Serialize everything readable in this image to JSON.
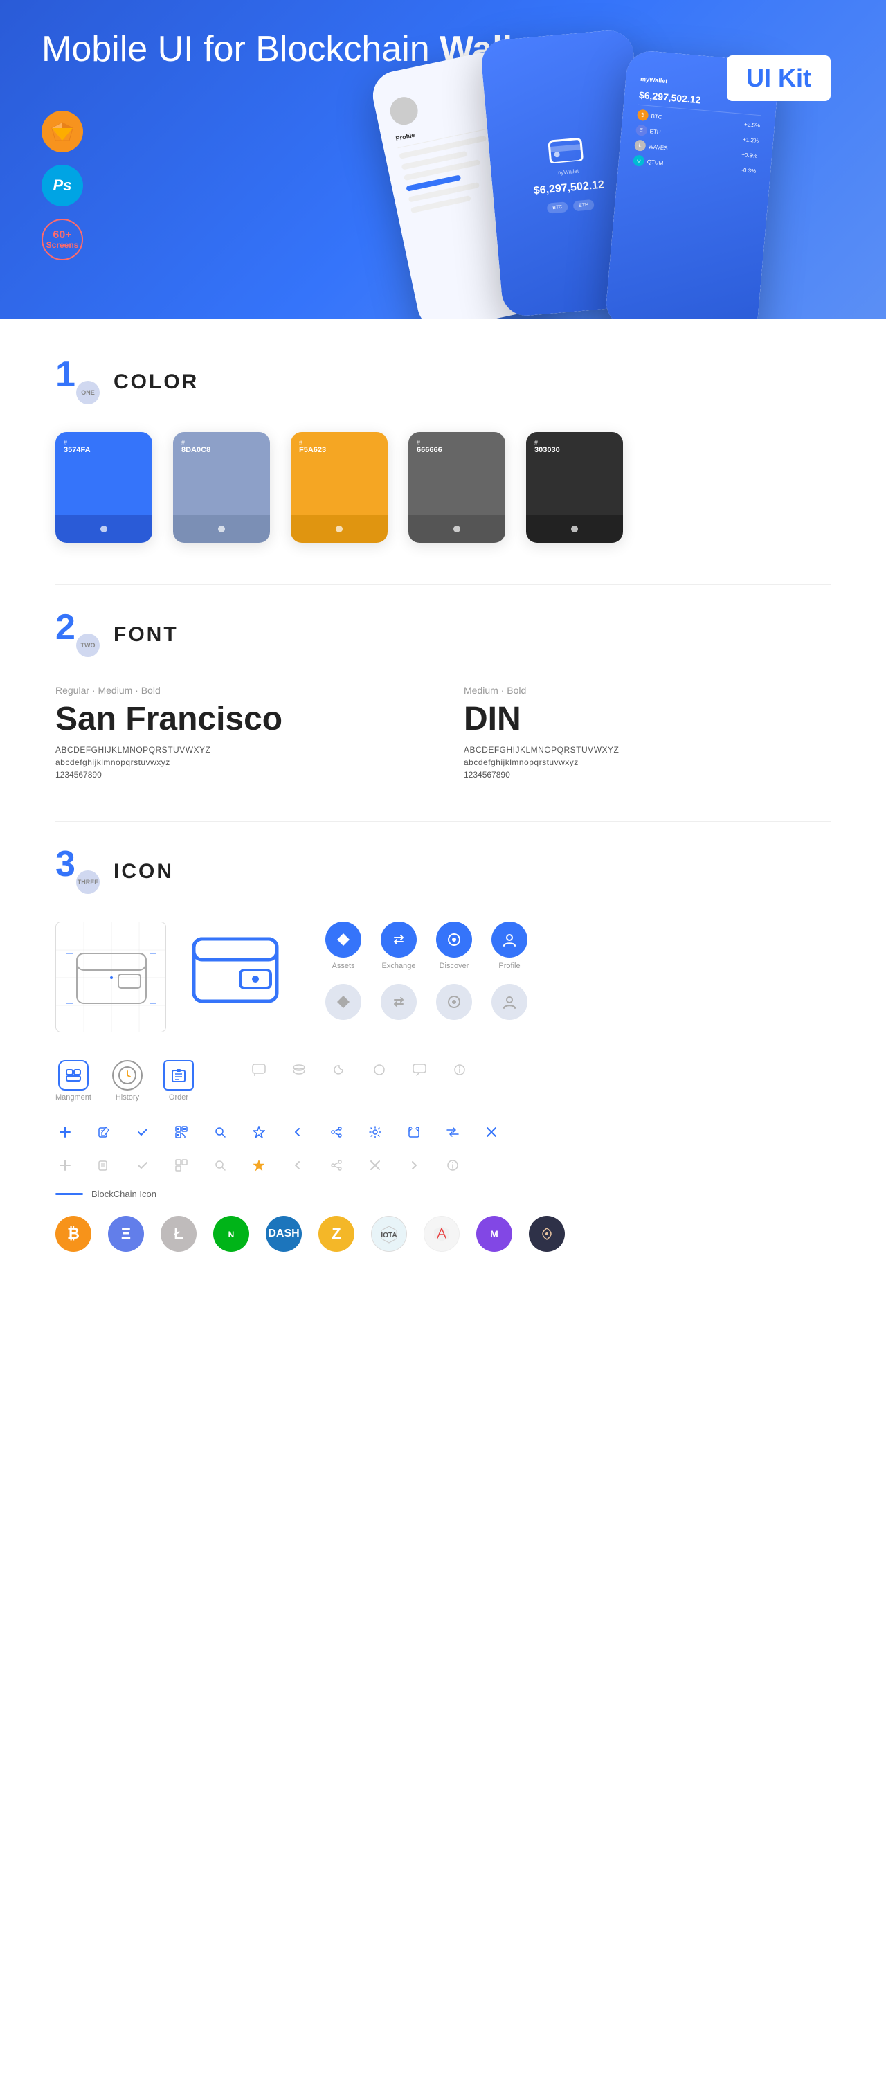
{
  "hero": {
    "title_normal": "Mobile UI for Blockchain ",
    "title_bold": "Wallet",
    "badge": "UI Kit",
    "badges": [
      {
        "name": "sketch",
        "label": "Sk"
      },
      {
        "name": "photoshop",
        "label": "Ps"
      },
      {
        "name": "screens",
        "label_top": "60+",
        "label_bottom": "Screens"
      }
    ]
  },
  "sections": {
    "color": {
      "number": "1",
      "number_label": "ONE",
      "title": "COLOR",
      "swatches": [
        {
          "hex": "#3574FA",
          "label": "#",
          "code": "3574FA"
        },
        {
          "hex": "#8DA0C8",
          "label": "#",
          "code": "8DA0C8"
        },
        {
          "hex": "#F5A623",
          "label": "#",
          "code": "F5A623"
        },
        {
          "hex": "#666666",
          "label": "#",
          "code": "666666"
        },
        {
          "hex": "#303030",
          "label": "#",
          "code": "303030"
        }
      ]
    },
    "font": {
      "number": "2",
      "number_label": "TWO",
      "title": "FONT",
      "fonts": [
        {
          "styles": "Regular · Medium · Bold",
          "name": "San Francisco",
          "uppercase": "ABCDEFGHIJKLMNOPQRSTUVWXYZ",
          "lowercase": "abcdefghijklmnopqrstuvwxyz",
          "numbers": "1234567890"
        },
        {
          "styles": "Medium · Bold",
          "name": "DIN",
          "uppercase": "ABCDEFGHIJKLMNOPQRSTUVWXYZ",
          "lowercase": "abcdefghijklmnopqrstuvwxyz",
          "numbers": "1234567890"
        }
      ]
    },
    "icon": {
      "number": "3",
      "number_label": "THREE",
      "title": "ICON",
      "nav_icons": [
        {
          "name": "Assets",
          "type": "diamond"
        },
        {
          "name": "Exchange",
          "type": "exchange"
        },
        {
          "name": "Discover",
          "type": "discover"
        },
        {
          "name": "Profile",
          "type": "profile"
        }
      ],
      "app_icons": [
        {
          "name": "Mangment",
          "type": "management"
        },
        {
          "name": "History",
          "type": "history"
        },
        {
          "name": "Order",
          "type": "order"
        }
      ],
      "blockchain_label": "BlockChain Icon",
      "crypto_coins": [
        "BTC",
        "ETH",
        "LTC",
        "NEO",
        "DASH",
        "ZEC",
        "IOTA",
        "ARK",
        "MATIC",
        "COSMOS"
      ]
    }
  }
}
